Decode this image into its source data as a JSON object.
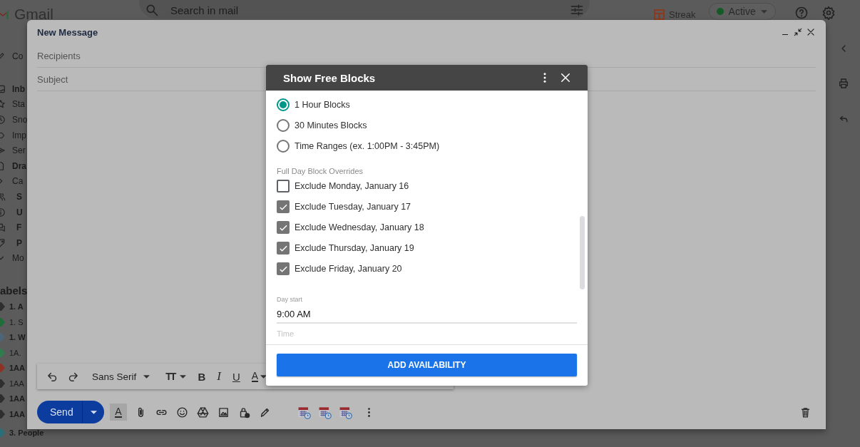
{
  "topbar": {
    "app_name": "Gmail",
    "search": {
      "placeholder": "Search in mail"
    },
    "streak": "Streak",
    "status": {
      "label": "Active"
    }
  },
  "sidebar": {
    "compose": "Co",
    "items": [
      {
        "label": "Inb",
        "unread": true
      },
      {
        "label": "Sta",
        "unread": false
      },
      {
        "label": "Sno",
        "unread": false
      },
      {
        "label": "Imp",
        "unread": false
      },
      {
        "label": "Ser",
        "unread": false
      },
      {
        "label": "Dra",
        "unread": true
      },
      {
        "label": "Ca",
        "unread": false,
        "children": [
          {
            "label": "S",
            "unread": true
          },
          {
            "label": "U",
            "unread": true
          },
          {
            "label": "F",
            "unread": true
          },
          {
            "label": "P",
            "unread": true
          }
        ]
      },
      {
        "label": "Mo",
        "unread": false
      }
    ],
    "labels_heading": "abels",
    "labels": [
      {
        "label": "1. A",
        "unread": true,
        "color": "#2e2e2e"
      },
      {
        "label": "1. S",
        "unread": false,
        "color": "#1f6e3a"
      },
      {
        "label": "1. W",
        "unread": true,
        "color": "#4d6577"
      },
      {
        "label": "1A.",
        "unread": false,
        "color": "#2f7d4c"
      },
      {
        "label": "1AA",
        "unread": true,
        "color": "#8e3323"
      },
      {
        "label": "1AA",
        "unread": false,
        "color": "#2e2e2e"
      },
      {
        "label": "1AA",
        "unread": true,
        "color": "#2e2e2e"
      },
      {
        "label": "1AA",
        "unread": true,
        "color": "#2e2e2e"
      },
      {
        "label": "3. People",
        "unread": true,
        "color": "#2a6f78"
      }
    ]
  },
  "compose": {
    "title": "New Message",
    "recipients": {
      "placeholder": "Recipients"
    },
    "subject": {
      "placeholder": "Subject"
    },
    "format": {
      "font": "Sans Serif",
      "buttons": [
        {
          "kind": "size",
          "label": "TT"
        },
        {
          "kind": "bold",
          "label": "B"
        },
        {
          "kind": "italic",
          "label": "I"
        },
        {
          "kind": "underline",
          "label": "U"
        },
        {
          "kind": "color",
          "label": "A"
        }
      ]
    },
    "send": "Send",
    "formatting_toggle": {
      "label": "A",
      "on": true
    }
  },
  "dialog": {
    "title": "Show Free Blocks",
    "block_types": [
      {
        "label": "1 Hour Blocks",
        "selected": true
      },
      {
        "label": "30 Minutes Blocks",
        "selected": false
      },
      {
        "label": "Time Ranges (ex. 1:00PM - 3:45PM)",
        "selected": false
      }
    ],
    "overrides_heading": "Full Day Block Overrides",
    "overrides": [
      {
        "label": "Exclude Monday, January 16",
        "checked": false
      },
      {
        "label": "Exclude Tuesday, January 17",
        "checked": true
      },
      {
        "label": "Exclude Wednesday, January 18",
        "checked": true
      },
      {
        "label": "Exclude Thursday, January 19",
        "checked": true
      },
      {
        "label": "Exclude Friday, January 20",
        "checked": true
      }
    ],
    "day_start": {
      "label": "Day start",
      "value": "9:00 AM"
    },
    "next_field_label": "Time",
    "action": "ADD AVAILABILITY"
  }
}
